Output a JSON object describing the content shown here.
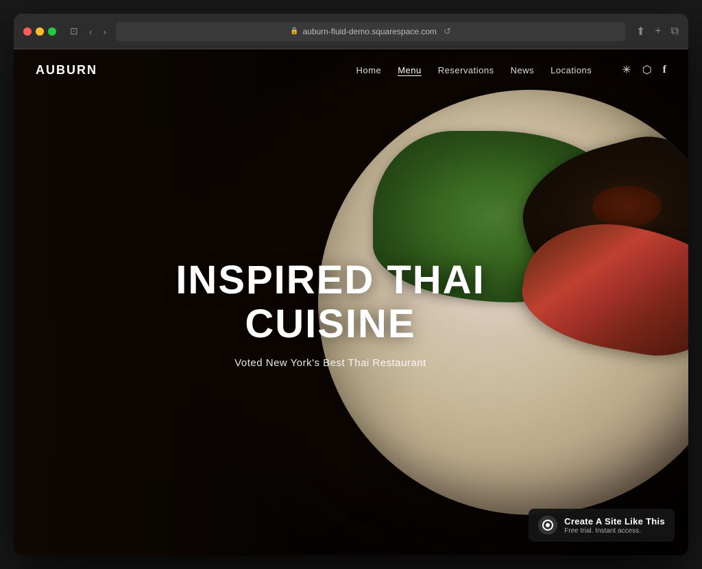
{
  "browser": {
    "url": "auburn-fluid-demo.squarespace.com",
    "back_btn": "‹",
    "forward_btn": "›",
    "window_icon": "⊡"
  },
  "nav": {
    "logo": "AUBURN",
    "links": [
      {
        "label": "Home",
        "active": false
      },
      {
        "label": "Menu",
        "active": true
      },
      {
        "label": "Reservations",
        "active": false
      },
      {
        "label": "News",
        "active": false
      },
      {
        "label": "Locations",
        "active": false
      }
    ],
    "social": [
      {
        "name": "yelp-icon",
        "symbol": "✳"
      },
      {
        "name": "instagram-icon",
        "symbol": "◻"
      },
      {
        "name": "facebook-icon",
        "symbol": "f"
      }
    ]
  },
  "hero": {
    "title_line1": "INSPIRED THAI",
    "title_line2": "CUISINE",
    "subtitle": "Voted New York's Best Thai Restaurant"
  },
  "squarespace_badge": {
    "title": "Create A Site Like This",
    "subtitle": "Free trial. Instant access."
  }
}
